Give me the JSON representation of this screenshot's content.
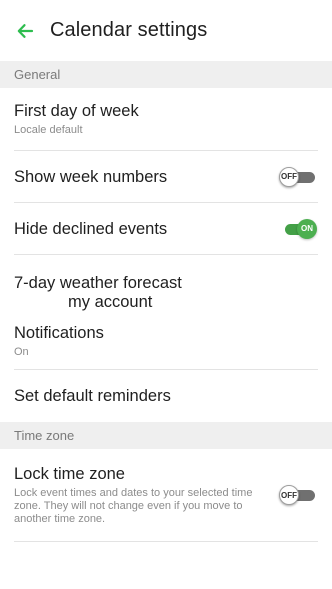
{
  "appbar": {
    "title": "Calendar settings",
    "back_icon": "arrow-left-icon",
    "accent_color": "#2ebd4f"
  },
  "sections": {
    "general": "General",
    "time_zone": "Time zone"
  },
  "settings": {
    "first_day": {
      "title": "First day of week",
      "subtitle": "Locale default"
    },
    "week_numbers": {
      "title": "Show week numbers",
      "toggle": "OFF"
    },
    "declined_events": {
      "title": "Hide declined events",
      "toggle": "ON"
    },
    "weather": {
      "title": "7-day weather forecast",
      "subtitle": "my account"
    },
    "notifications": {
      "title": "Notifications",
      "subtitle": "On"
    },
    "default_reminders": {
      "title": "Set default reminders"
    },
    "lock_time_zone": {
      "title": "Lock time zone",
      "subtitle": "Lock event times and dates to your selected time zone. They will not change even if you move to another time zone.",
      "toggle": "OFF"
    }
  },
  "colors": {
    "toggle_on": "#4caf50",
    "toggle_off_track": "#707070",
    "section_bg": "#efefef"
  }
}
